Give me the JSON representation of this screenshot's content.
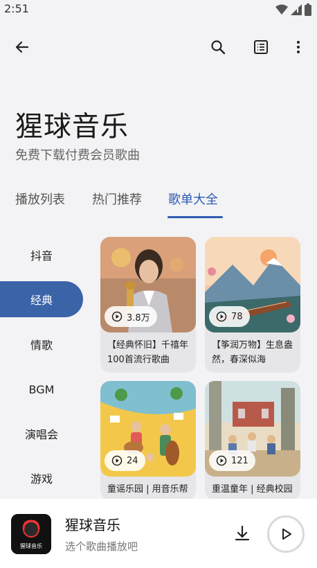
{
  "status": {
    "time": "2:51"
  },
  "header": {
    "back_icon": "arrow-left-icon",
    "search_icon": "search-icon",
    "list_icon": "list-icon",
    "more_icon": "more-vert-icon"
  },
  "hero": {
    "title": "猩球音乐",
    "subtitle": "免费下载付费会员歌曲"
  },
  "tabs": [
    {
      "label": "播放列表"
    },
    {
      "label": "热门推荐"
    },
    {
      "label": "歌单大全"
    }
  ],
  "active_tab": "歌单大全",
  "sidebar": {
    "items": [
      {
        "label": "抖音"
      },
      {
        "label": "经典"
      },
      {
        "label": "情歌"
      },
      {
        "label": "BGM"
      },
      {
        "label": "演唱会"
      },
      {
        "label": "游戏"
      }
    ],
    "active": "经典"
  },
  "cards": [
    {
      "plays": "3.8万",
      "title": "【经典怀旧】千禧年100首流行歌曲"
    },
    {
      "plays": "78",
      "title": "【筝润万物】生息盎然，春深似海"
    },
    {
      "plays": "24",
      "title": "童谣乐园 | 用音乐帮"
    },
    {
      "plays": "121",
      "title": "重温童年 | 经典校园"
    }
  ],
  "player": {
    "title": "猩球音乐",
    "subtitle": "选个歌曲播放吧",
    "cover_text": "猩球音乐"
  },
  "colors": {
    "accent": "#2d5bb1",
    "sidebar_active": "#3b63a8",
    "background": "#f3f3f5"
  }
}
